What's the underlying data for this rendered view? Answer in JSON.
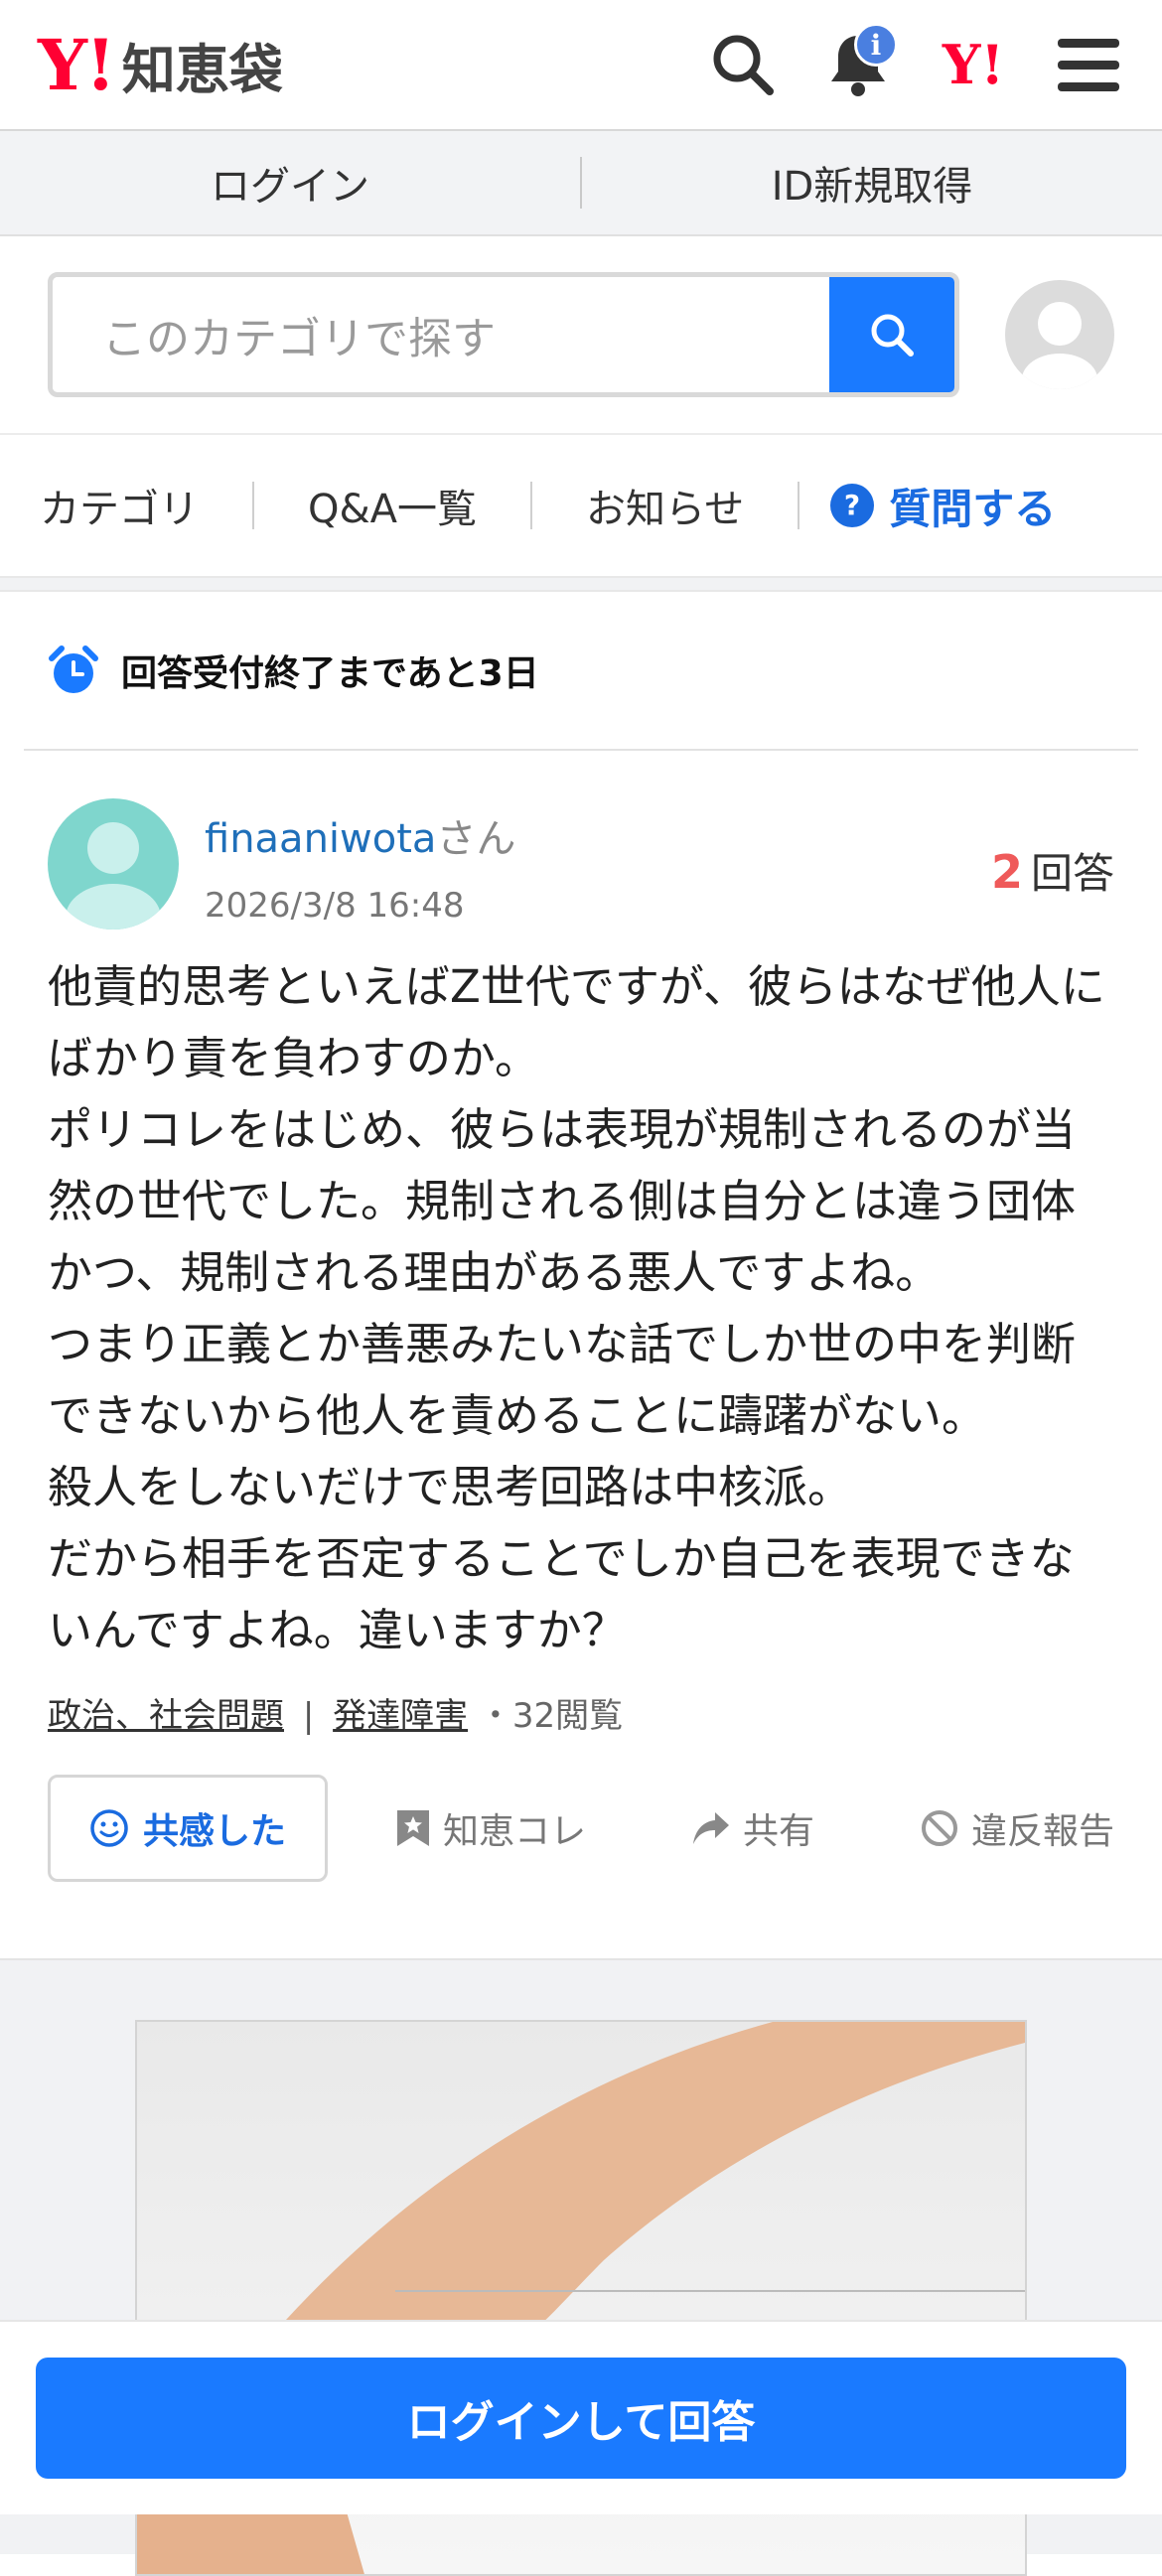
{
  "header": {
    "logo_y": "Y!",
    "logo_name": "知恵袋",
    "notification_badge": "i",
    "yahoo_mark": "Y!",
    "icons": [
      "search-icon",
      "bell-icon",
      "yahoo-logo-icon",
      "hamburger-menu-icon"
    ]
  },
  "login_bar": {
    "login": "ログイン",
    "register": "ID新規取得"
  },
  "search": {
    "placeholder": "このカテゴリで探す"
  },
  "tabs": {
    "category": "カテゴリ",
    "qa_list": "Q&A一覧",
    "news": "お知らせ",
    "ask": "質問する"
  },
  "deadline": {
    "text": "回答受付終了まであと3日"
  },
  "question": {
    "user_name": "finaaniwota",
    "user_suffix": "さん",
    "date": "2026/3/8 16:48",
    "answer_count": "2",
    "answer_label": "回答",
    "body": "他責的思考といえばZ世代ですが、彼らはなぜ他人にばかり責を負わすのか。\nポリコレをはじめ、彼らは表現が規制されるのが当然の世代でした。規制される側は自分とは違う団体かつ、規制される理由がある悪人ですよね。\nつまり正義とか善悪みたいな話でしか世の中を判断できないから他人を責めることに躊躇がない。\n殺人をしないだけで思考回路は中核派。\nだから相手を否定することでしか自己を表現できないんですよね。違いますか？",
    "tag1": "政治、社会問題",
    "tag_sep": "|",
    "tag2": "発達障害",
    "views": "・32閲覧"
  },
  "actions": {
    "empathize": "共感した",
    "chie_kore": "知恵コレ",
    "share": "共有",
    "report": "違反報告"
  },
  "bottom": {
    "login_answer": "ログインして回答"
  },
  "colors": {
    "accent_blue": "#1a7aff",
    "yahoo_red": "#ff0033",
    "count_red": "#ef5a5a"
  }
}
